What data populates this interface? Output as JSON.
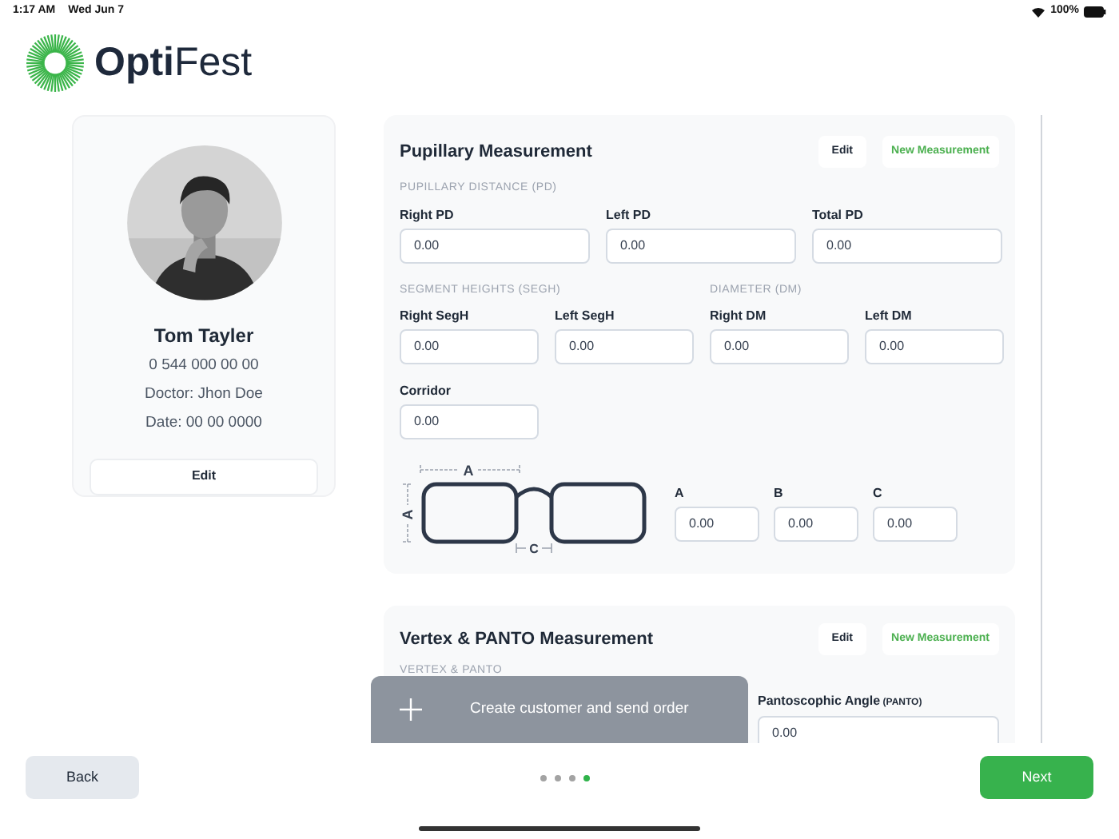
{
  "status_bar": {
    "time": "1:17 AM",
    "date": "Wed Jun 7",
    "battery": "100%"
  },
  "logo": {
    "text": "**Opti**Fest"
  },
  "profile": {
    "name": "Tom Tayler",
    "phone": "0 544 000 00 00",
    "doctor": "Doctor: Jhon Doe",
    "date": "Date: 00 00 0000",
    "edit_button": "Edit"
  },
  "pupillary": {
    "title": "Pupillary Measurement",
    "edit_button": "Edit",
    "new_button": "New Measurement",
    "rows": [
      {
        "kind": "thirds",
        "groups": [
          {
            "heading": "PUPILLARY DISTANCE (PD)",
            "fields": [
              {
                "label": "Right PD",
                "value": "0.00"
              },
              {
                "label": "Left PD",
                "value": "0.00"
              },
              {
                "label": "Total PD",
                "value": "0.00"
              }
            ]
          }
        ]
      },
      {
        "kind": "quarters",
        "groups": [
          {
            "heading": "SEGMENT HEIGHTS (SEGH)",
            "fields": [
              {
                "label": "Right SegH",
                "value": "0.00"
              },
              {
                "label": "Left SegH",
                "value": "0.00"
              }
            ]
          },
          {
            "heading": "DIAMETER (DM)",
            "fields": [
              {
                "label": "Right DM",
                "value": "0.00"
              },
              {
                "label": "Left DM",
                "value": "0.00"
              }
            ]
          }
        ]
      },
      {
        "kind": "quarters",
        "groups": [
          {
            "fields": [
              {
                "label": "Corridor",
                "value": "0.00"
              }
            ]
          }
        ]
      }
    ],
    "frame": {
      "width_label": "A",
      "height_label": "A",
      "bridge_label": "C",
      "fields": [
        {
          "label": "A",
          "value": "0.00"
        },
        {
          "label": "B",
          "value": "0.00"
        },
        {
          "label": "C",
          "value": "0.00"
        }
      ]
    }
  },
  "vertex": {
    "title": "Vertex & PANTO Measurement",
    "edit_button": "Edit",
    "new_button": "New Measurement",
    "heading": "VERTEX & PANTO",
    "fields": [
      {
        "label": "Pantoscophic Angle",
        "note": "(PANTO)",
        "value": "0.00"
      }
    ]
  },
  "toast": {
    "text": "Create customer and send order"
  },
  "footer": {
    "back_button": "Back",
    "next_button": "Next",
    "pages": [
      {
        "selected": false
      },
      {
        "selected": false
      },
      {
        "selected": false
      },
      {
        "selected": true
      }
    ]
  }
}
